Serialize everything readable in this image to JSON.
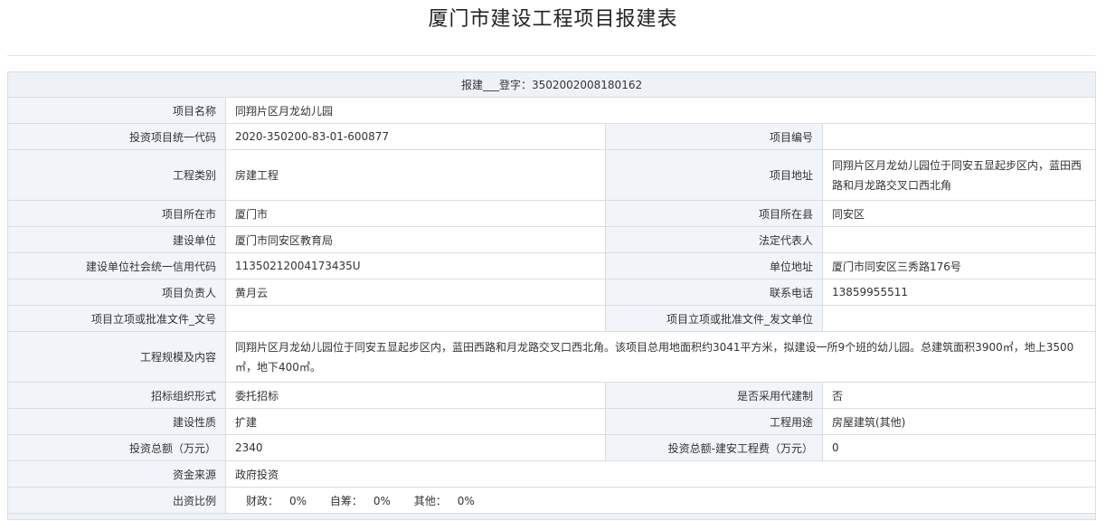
{
  "page_title": "厦门市建设工程项目报建表",
  "reg_header": "报建___登字：3502002008180162",
  "fields": {
    "project_name_label": "项目名称",
    "project_name": "同翔片区月龙幼儿园",
    "invest_code_label": "投资项目统一代码",
    "invest_code": "2020-350200-83-01-600877",
    "project_no_label": "项目编号",
    "project_no": "",
    "eng_type_label": "工程类别",
    "eng_type": "房建工程",
    "address_label": "项目地址",
    "address": "同翔片区月龙幼儿园位于同安五显起步区内，蓝田西路和月龙路交叉口西北角",
    "city_label": "项目所在市",
    "city": "厦门市",
    "county_label": "项目所在县",
    "county": "同安区",
    "builder_label": "建设单位",
    "builder": "厦门市同安区教育局",
    "legal_rep_label": "法定代表人",
    "legal_rep": "",
    "credit_code_label": "建设单位社会统一信用代码",
    "credit_code": "11350212004173435U",
    "unit_address_label": "单位地址",
    "unit_address": "厦门市同安区三秀路176号",
    "manager_label": "项目负责人",
    "manager": "黄月云",
    "phone_label": "联系电话",
    "phone": "13859955511",
    "approval_doc_label": "项目立项或批准文件_文号",
    "approval_doc": "",
    "approval_unit_label": "项目立项或批准文件_发文单位",
    "approval_unit": "",
    "scale_label": "工程规模及内容",
    "scale": "同翔片区月龙幼儿园位于同安五显起步区内，蓝田西路和月龙路交叉口西北角。该项目总用地面积约3041平方米，拟建设一所9个班的幼儿园。总建筑面积3900㎡，地上3500㎡，地下400㎡。",
    "bidding_label": "招标组织形式",
    "bidding": "委托招标",
    "agent_build_label": "是否采用代建制",
    "agent_build": "否",
    "nature_label": "建设性质",
    "nature": "扩建",
    "usage_label": "工程用途",
    "usage": "房屋建筑(其他)",
    "total_invest_label": "投资总额（万元）",
    "total_invest": "2340",
    "install_cost_label": "投资总额-建安工程费（万元）",
    "install_cost": "0",
    "fund_source_label": "资金来源",
    "fund_source": "政府投资",
    "ratio_label": "出资比例",
    "ratio": [
      {
        "name": "财政：",
        "value": "0%"
      },
      {
        "name": "自筹：",
        "value": "0%"
      },
      {
        "name": "其他：",
        "value": "0%"
      }
    ]
  }
}
